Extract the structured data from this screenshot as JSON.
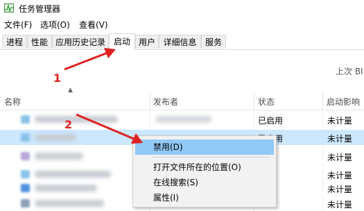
{
  "window": {
    "title": "任务管理器"
  },
  "menu": [
    {
      "label": "文件(F)"
    },
    {
      "label": "选项(O)"
    },
    {
      "label": "查看(V)"
    }
  ],
  "tabs": [
    {
      "label": "进程"
    },
    {
      "label": "性能"
    },
    {
      "label": "应用历史记录"
    },
    {
      "label": "启动",
      "active": true
    },
    {
      "label": "用户"
    },
    {
      "label": "详细信息"
    },
    {
      "label": "服务"
    }
  ],
  "last_bios_label": "上次 BI",
  "table": {
    "columns": {
      "name": "名称",
      "publisher": "发布者",
      "status": "状态",
      "impact": "启动影响"
    },
    "rows": [
      {
        "status": "已启用",
        "impact": "未计量",
        "selected": false
      },
      {
        "status": "已启用",
        "impact": "未计量",
        "selected": true
      },
      {
        "status": "",
        "impact": "未计量",
        "selected": false
      },
      {
        "status": "",
        "impact": "未计量",
        "selected": false
      },
      {
        "status": "",
        "impact": "未计量",
        "selected": false
      },
      {
        "status": "",
        "impact": "未计量",
        "selected": false
      }
    ]
  },
  "context_menu": {
    "items": [
      {
        "label": "禁用(D)",
        "highlighted": true
      },
      {
        "label": "打开文件所在的位置(O)"
      },
      {
        "label": "在线搜索(S)"
      },
      {
        "label": "属性(I)"
      }
    ]
  },
  "annotations": [
    {
      "label": "1"
    },
    {
      "label": "2"
    }
  ],
  "colors": {
    "annotation": "#e02020",
    "selection": "#cce8ff",
    "menu_highlight": "#91c9f7"
  }
}
